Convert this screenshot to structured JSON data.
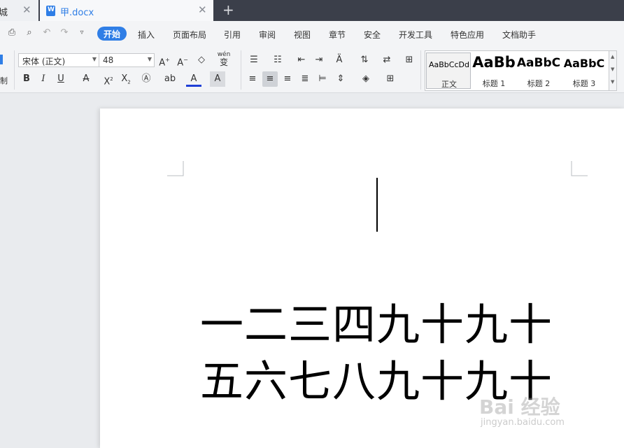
{
  "tabs": [
    {
      "label": "商城",
      "shown_fragment": "商城"
    },
    {
      "label": "甲.docx"
    }
  ],
  "menu": {
    "items": [
      "开始",
      "插入",
      "页面布局",
      "引用",
      "审阅",
      "视图",
      "章节",
      "安全",
      "开发工具",
      "特色应用",
      "文档助手"
    ]
  },
  "ribbon": {
    "font_name": "宋体 (正文)",
    "font_size": "48",
    "left_fragment": "制",
    "styles": [
      {
        "preview": "AaBbCcDd",
        "label": "正文"
      },
      {
        "preview": "AaBb",
        "label": "标题 1"
      },
      {
        "preview": "AaBbC",
        "label": "标题 2"
      },
      {
        "preview": "AaBbC",
        "label": "标题 3"
      }
    ],
    "phonetic_glyph": "wén",
    "phonetic_char": "变"
  },
  "document": {
    "lines": [
      "一二三四九十九十",
      "五六七八九十九十"
    ]
  },
  "watermark": {
    "text": "Bai 经验",
    "sub": "jingyan.baidu.com"
  },
  "colors": {
    "accent": "#2f7ee6",
    "tabbar": "#3b3f4a",
    "font_color_bar": "#1f3fd6"
  }
}
